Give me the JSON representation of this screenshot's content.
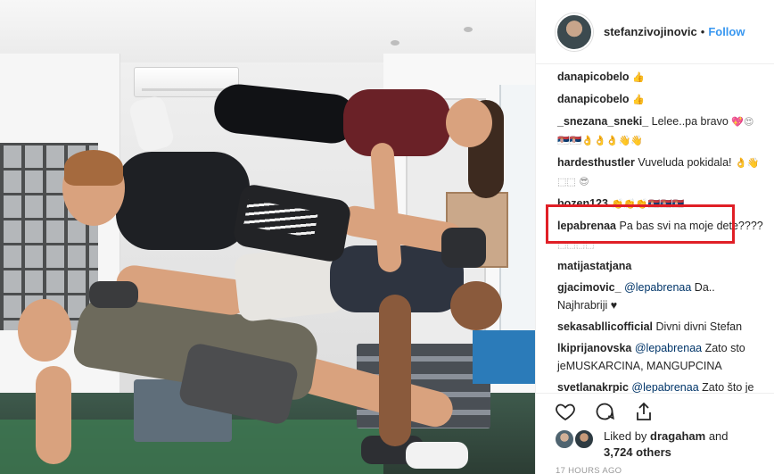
{
  "post": {
    "username": "stefanzivojinovic",
    "separator": "•",
    "follow_label": "Follow"
  },
  "comments": [
    {
      "user": "danapicobelo",
      "text": "",
      "emoji": "👍"
    },
    {
      "user": "danapicobelo",
      "text": "",
      "emoji": "👍"
    },
    {
      "user": "_snezana_sneki_",
      "text": "Lelee..pa bravo",
      "emoji": "💖😍 🇷🇸🇷🇸👌👌👌👋👋"
    },
    {
      "user": "hardesthustler",
      "text": "Vuveluda pokidala!",
      "emoji": "👌👋 ⬚⬚ 😎"
    },
    {
      "user": "bozen123",
      "text": "",
      "emoji": "👏👏👏🇷🇸🇷🇸🇷🇸"
    },
    {
      "user": "lepabrenaa",
      "text": "Pa bas svi na moje dete????",
      "emoji": "⬚⬚⬚⬚"
    },
    {
      "user": "matijastatjana",
      "text": "",
      "emoji": ""
    },
    {
      "user": "gjacimovic_",
      "mention": "@lepabrenaa",
      "text": "Da.. Najhrabriji ♥",
      "emoji": ""
    },
    {
      "user": "sekasabllicofficial",
      "text": "Divni divni Stefan",
      "emoji": ""
    },
    {
      "user": "lkiprijanovska",
      "mention": "@lepabrenaa",
      "text": "Zato sto jeMUSKARCINA, MANGUPCINA",
      "emoji": ""
    },
    {
      "user": "svetlanakrpic",
      "mention": "@lepabrenaa",
      "text": "Zato što je najjače, zato što je tvoje, podnosi svaki",
      "emoji": ""
    }
  ],
  "actions": {
    "like_icon": "heart-icon",
    "comment_icon": "comment-icon",
    "share_icon": "share-icon"
  },
  "likes": {
    "prefix": "Liked by",
    "user": "dragaham",
    "conjunction": "and",
    "others": "3,724 others"
  },
  "timestamp": "17 HOURS AGO",
  "colors": {
    "follow": "#3897f0",
    "highlight": "#e01f26",
    "mention": "#003569"
  }
}
